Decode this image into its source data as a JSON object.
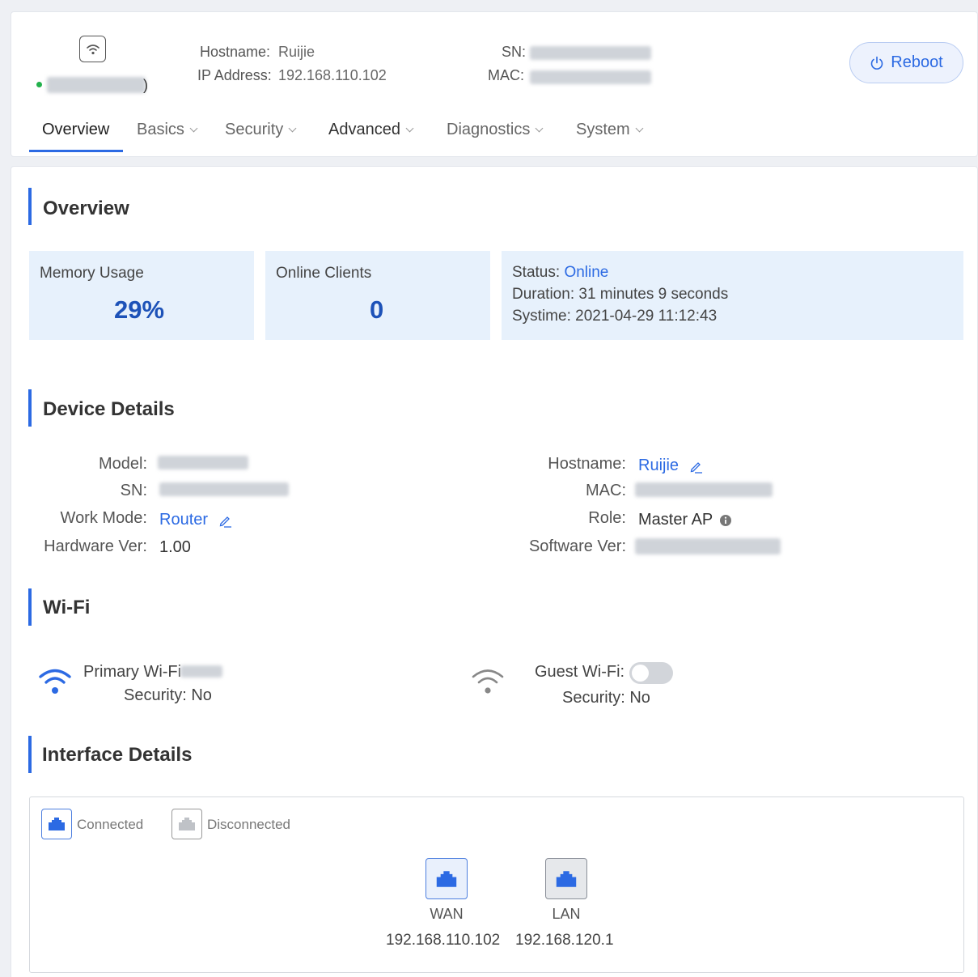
{
  "header": {
    "hostname_label": "Hostname:",
    "hostname_value": "Ruijie",
    "ip_label": "IP Address:",
    "ip_value": "192.168.110.102",
    "sn_label": "SN:",
    "mac_label": "MAC:",
    "reboot_label": "Reboot",
    "device_suffix": ")"
  },
  "tabs": [
    {
      "label": "Overview",
      "active": true
    },
    {
      "label": "Basics"
    },
    {
      "label": "Security"
    },
    {
      "label": "Advanced"
    },
    {
      "label": "Diagnostics"
    },
    {
      "label": "System"
    }
  ],
  "overview": {
    "title": "Overview",
    "memory_label": "Memory Usage",
    "memory_value": "29%",
    "clients_label": "Online Clients",
    "clients_value": "0",
    "status_label": "Status:",
    "status_value": "Online",
    "duration_label": "Duration:",
    "duration_value": "31 minutes 9 seconds",
    "systime_label": "Systime:",
    "systime_value": "2021-04-29 11:12:43"
  },
  "device": {
    "title": "Device Details",
    "model_label": "Model:",
    "sn_label": "SN:",
    "workmode_label": "Work Mode:",
    "workmode_value": "Router",
    "hwver_label": "Hardware Ver:",
    "hwver_value": "1.00",
    "hostname_label": "Hostname:",
    "hostname_value": "Ruijie",
    "mac_label": "MAC:",
    "role_label": "Role:",
    "role_value": "Master AP",
    "swver_label": "Software Ver:"
  },
  "wifi": {
    "title": "Wi-Fi",
    "primary_label": "Primary Wi-Fi",
    "primary_security": "Security: No",
    "guest_label": "Guest Wi-Fi:",
    "guest_security": "Security: No",
    "guest_enabled": false
  },
  "interfaces": {
    "title": "Interface Details",
    "legend_connected": "Connected",
    "legend_disconnected": "Disconnected",
    "ports": [
      {
        "name": "WAN",
        "ip": "192.168.110.102"
      },
      {
        "name": "LAN",
        "ip": "192.168.120.1"
      }
    ]
  },
  "colors": {
    "accent": "#2c6ae3",
    "online_dot": "#22b14c",
    "stat_bg": "#e7f1fc"
  }
}
